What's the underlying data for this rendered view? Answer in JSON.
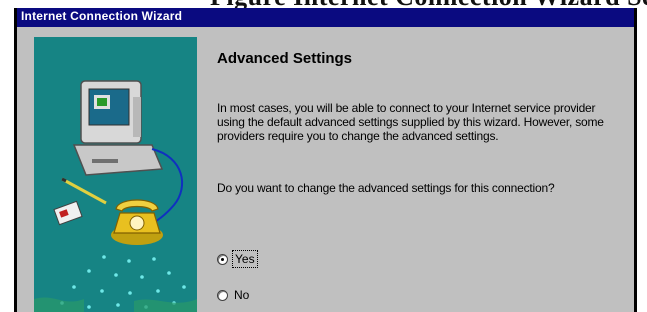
{
  "page_caption": "Figure Internet Connection Wizard Settings",
  "window": {
    "title": "Internet Connection Wizard"
  },
  "page": {
    "heading": "Advanced Settings",
    "paragraph": "In most cases, you will be able to connect to your Internet service provider using the default advanced settings supplied by this wizard. However, some providers require you to change the advanced settings.",
    "question": "Do you want to change the advanced settings for this connection?",
    "options": [
      {
        "label": "Yes",
        "selected": true
      },
      {
        "label": "No",
        "selected": false
      }
    ]
  },
  "illustration": {
    "subject": "computer-with-telephone",
    "colors": {
      "background": "#168484",
      "monitor": "#d8d8d8",
      "phone": "#e8c020",
      "dots": "#6fe8e8"
    }
  },
  "colors": {
    "titlebar": "#0a0a80",
    "dialog_face": "#c0c0c0"
  }
}
